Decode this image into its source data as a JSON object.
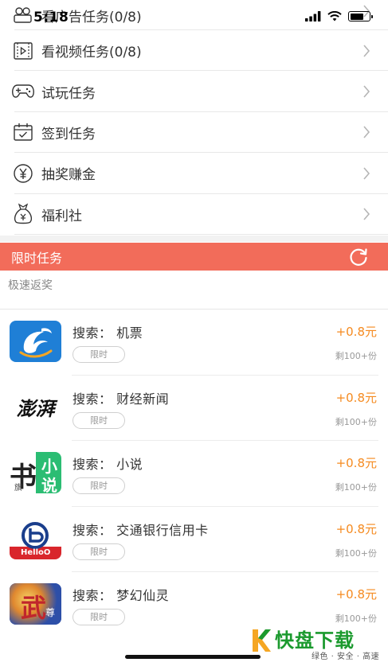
{
  "status_bar": {
    "time": "5:18"
  },
  "menu": {
    "items": [
      {
        "label": "看广告任务(0/8)",
        "icon": "users-icon"
      },
      {
        "label": "看视频任务(0/8)",
        "icon": "video-icon"
      },
      {
        "label": "试玩任务",
        "icon": "gamepad-icon"
      },
      {
        "label": "签到任务",
        "icon": "calendar-check-icon"
      },
      {
        "label": "抽奖赚金",
        "icon": "yen-coin-icon"
      },
      {
        "label": "福利社",
        "icon": "money-bag-icon"
      }
    ]
  },
  "section": {
    "title": "限时任务"
  },
  "sub_section": {
    "title": "极速返奖"
  },
  "tasks": [
    {
      "name": "搜索：  机票",
      "tag": "限时",
      "reward": "+0.8元",
      "remain": "剩100+份",
      "logo": "dolphin-app-logo"
    },
    {
      "name": "搜索：  财经新闻",
      "tag": "限时",
      "reward": "+0.8元",
      "remain": "剩100+份",
      "logo": "澎湃"
    },
    {
      "name": "搜索：  小说",
      "tag": "限时",
      "reward": "+0.8元",
      "remain": "剩100+份",
      "logo": "书旗小说"
    },
    {
      "name": "搜索：  交通银行信用卡",
      "tag": "限时",
      "reward": "+0.8元",
      "remain": "剩100+份",
      "logo": "bank-app-logo"
    },
    {
      "name": "搜索：  梦幻仙灵",
      "tag": "限时",
      "reward": "+0.8元",
      "remain": "剩100+份",
      "logo": "game-app-logo"
    }
  ],
  "logo_text": {
    "pengpai": "澎湃",
    "shuqi_1": "书",
    "shuqi_2": "小",
    "shuqi_3": "说",
    "shuqi_4": "旗",
    "bank": "HelloO",
    "game": "武",
    "game_sub": "尊"
  },
  "watermark": {
    "brand": "快盘下载",
    "slogan": "绿色 · 安全 · 高速"
  },
  "colors": {
    "accent": "#f26c5a",
    "reward": "#f58a1f",
    "watermark": "#1b9a2e"
  }
}
